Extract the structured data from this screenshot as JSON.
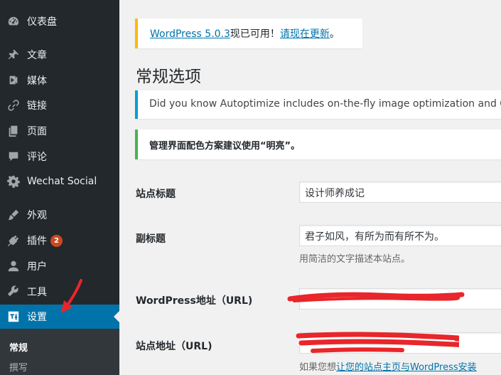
{
  "sidebar": {
    "items": [
      {
        "label": "仪表盘",
        "icon": "dashboard-icon"
      },
      {
        "label": "文章",
        "icon": "pushpin-icon"
      },
      {
        "label": "媒体",
        "icon": "media-icon"
      },
      {
        "label": "链接",
        "icon": "link-icon"
      },
      {
        "label": "页面",
        "icon": "pages-icon"
      },
      {
        "label": "评论",
        "icon": "comment-icon"
      },
      {
        "label": "Wechat Social",
        "icon": "gear-icon"
      },
      {
        "label": "外观",
        "icon": "appearance-brush-icon"
      },
      {
        "label": "插件",
        "icon": "plugins-icon",
        "badge": "2"
      },
      {
        "label": "用户",
        "icon": "users-icon"
      },
      {
        "label": "工具",
        "icon": "tools-wrench-icon"
      },
      {
        "label": "设置",
        "icon": "settings-icon",
        "active": true
      }
    ],
    "submenu": [
      {
        "label": "常规",
        "current": true
      },
      {
        "label": "撰写"
      }
    ]
  },
  "update_notice": {
    "version_link": "WordPress 5.0.3",
    "text": "现已可用！",
    "update_link": "请现在更新",
    "end": "。"
  },
  "page_title": "常规选项",
  "info_notice": "Did you know Autoptimize includes on-the-fly image optimization and CDN",
  "success_notice": "管理界面配色方案建议使用“明亮”。",
  "form": {
    "site_title": {
      "label": "站点标题",
      "value": "设计师养成记"
    },
    "tagline": {
      "label": "副标题",
      "value": "君子如风，有所为而有所不为。",
      "description": "用简洁的文字描述本站点。"
    },
    "wp_address": {
      "label": "WordPress地址（URL)"
    },
    "site_address": {
      "label": "站点地址（URL)",
      "desc_prefix": "如果您想",
      "desc_link": "让您的站点主页与WordPress安装"
    }
  },
  "colors": {
    "sidebar_bg": "#23282d",
    "active_bg": "#0073aa",
    "badge": "#ca4a1f",
    "link": "#0073aa",
    "redaction": "#e8262b"
  }
}
